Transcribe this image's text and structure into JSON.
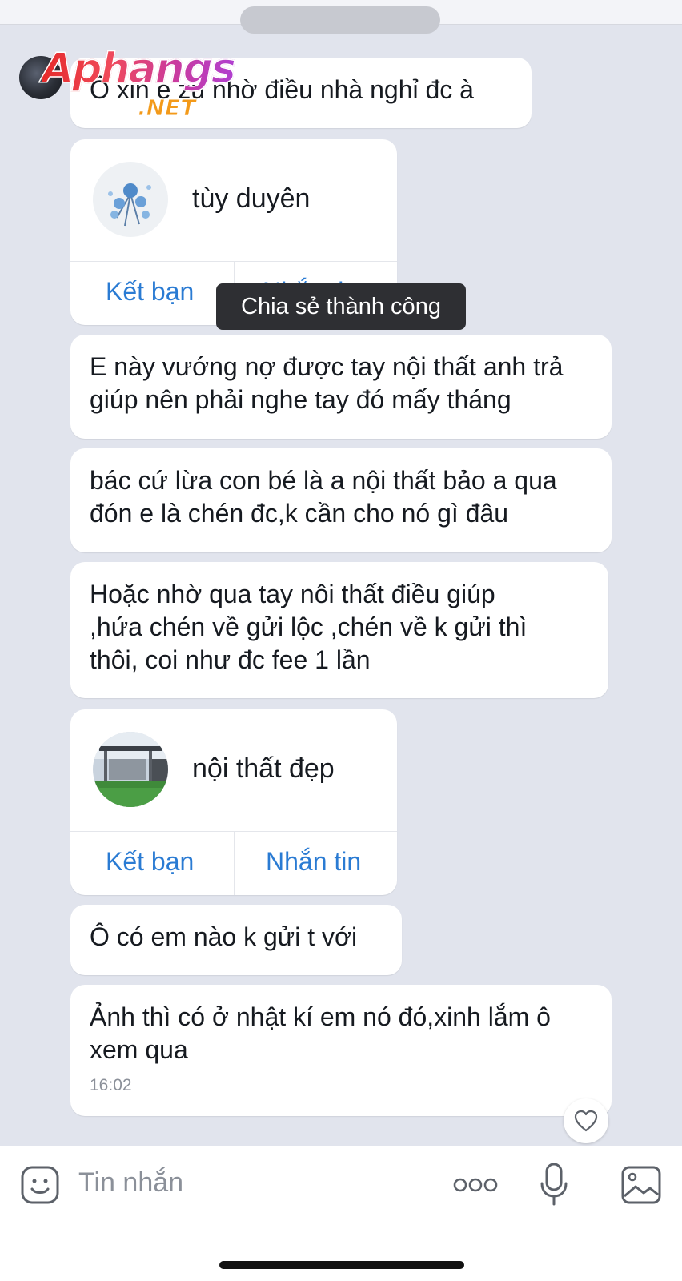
{
  "watermark": {
    "brand": "Aphangs",
    "suffix": ".NET"
  },
  "messages": {
    "m1": "Ô xin e zu nhờ điều nhà nghỉ đc à",
    "m2": "E này vướng nợ được tay nội thất anh trả giúp nên phải nghe tay đó mấy tháng",
    "m3": "bác cứ lừa con bé là a nội thất bảo a qua đón e là chén đc,k cần cho nó gì đâu",
    "m4": "Hoặc nhờ qua tay nôi thất điều giúp ,hứa chén về gửi lộc ,chén về k gửi thì thôi, coi như đc fee 1 lần",
    "m5": "Ô có em nào k gửi t với",
    "m6": "Ảnh thì có ở nhật kí em nó đó,xinh lắm ô xem qua",
    "m6_time": "16:02"
  },
  "contact_cards": [
    {
      "name": "tùy duyên",
      "add_friend_label": "Kết bạn",
      "message_label": "Nhắn tin"
    },
    {
      "name": "nội thất đẹp",
      "add_friend_label": "Kết bạn",
      "message_label": "Nhắn tin"
    }
  ],
  "toast": {
    "text": "Chia sẻ thành công"
  },
  "composer": {
    "placeholder": "Tin nhắn"
  },
  "colors": {
    "background": "#e1e4ed",
    "bubble": "#ffffff",
    "link": "#2a7bd3",
    "toast": "#2e2f33"
  }
}
